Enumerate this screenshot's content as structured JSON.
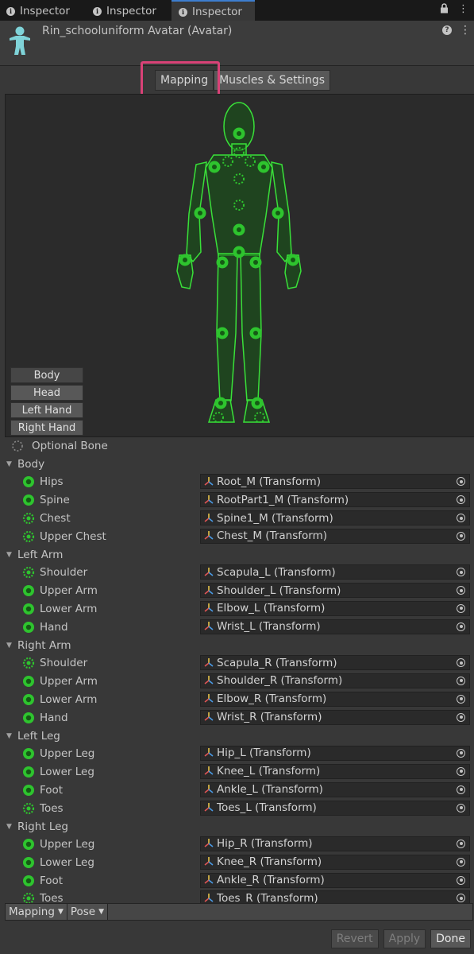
{
  "tabs": [
    {
      "label": "Inspector",
      "active": false
    },
    {
      "label": "Inspector",
      "active": false
    },
    {
      "label": "Inspector",
      "active": true
    }
  ],
  "window_controls": {
    "lock_icon": "lock-icon",
    "menu_icon": "kebab-icon"
  },
  "header": {
    "title": "Rin_schooluniform Avatar (Avatar)",
    "icon": "avatar-figure-icon",
    "help_icon": "help-icon",
    "menu_icon": "kebab-icon"
  },
  "segment": {
    "mapping_label": "Mapping",
    "muscles_label": "Muscles & Settings"
  },
  "body_parts": [
    "Body",
    "Head",
    "Left Hand",
    "Right Hand"
  ],
  "optional_bone_label": "Optional Bone",
  "groups": [
    {
      "name": "Body",
      "bones": [
        {
          "label": "Hips",
          "value": "Root_M (Transform)",
          "optional": false
        },
        {
          "label": "Spine",
          "value": "RootPart1_M (Transform)",
          "optional": false
        },
        {
          "label": "Chest",
          "value": "Spine1_M (Transform)",
          "optional": true
        },
        {
          "label": "Upper Chest",
          "value": "Chest_M (Transform)",
          "optional": true
        }
      ]
    },
    {
      "name": "Left Arm",
      "bones": [
        {
          "label": "Shoulder",
          "value": "Scapula_L (Transform)",
          "optional": true
        },
        {
          "label": "Upper Arm",
          "value": "Shoulder_L (Transform)",
          "optional": false
        },
        {
          "label": "Lower Arm",
          "value": "Elbow_L (Transform)",
          "optional": false
        },
        {
          "label": "Hand",
          "value": "Wrist_L (Transform)",
          "optional": false
        }
      ]
    },
    {
      "name": "Right Arm",
      "bones": [
        {
          "label": "Shoulder",
          "value": "Scapula_R (Transform)",
          "optional": true
        },
        {
          "label": "Upper Arm",
          "value": "Shoulder_R (Transform)",
          "optional": false
        },
        {
          "label": "Lower Arm",
          "value": "Elbow_R (Transform)",
          "optional": false
        },
        {
          "label": "Hand",
          "value": "Wrist_R (Transform)",
          "optional": false
        }
      ]
    },
    {
      "name": "Left Leg",
      "bones": [
        {
          "label": "Upper Leg",
          "value": "Hip_L (Transform)",
          "optional": false
        },
        {
          "label": "Lower Leg",
          "value": "Knee_L (Transform)",
          "optional": false
        },
        {
          "label": "Foot",
          "value": "Ankle_L (Transform)",
          "optional": false
        },
        {
          "label": "Toes",
          "value": "Toes_L (Transform)",
          "optional": true
        }
      ]
    },
    {
      "name": "Right Leg",
      "bones": [
        {
          "label": "Upper Leg",
          "value": "Hip_R (Transform)",
          "optional": false
        },
        {
          "label": "Lower Leg",
          "value": "Knee_R (Transform)",
          "optional": false
        },
        {
          "label": "Foot",
          "value": "Ankle_R (Transform)",
          "optional": false
        },
        {
          "label": "Toes",
          "value": "Toes_R (Transform)",
          "optional": true
        }
      ]
    }
  ],
  "toolbar": {
    "mapping_label": "Mapping",
    "pose_label": "Pose"
  },
  "footer": {
    "revert_label": "Revert",
    "apply_label": "Apply",
    "done_label": "Done"
  },
  "colors": {
    "accent": "#3d7ecf",
    "bone_green": "#2ec42e",
    "highlight": "#d94277",
    "background": "#383838"
  }
}
